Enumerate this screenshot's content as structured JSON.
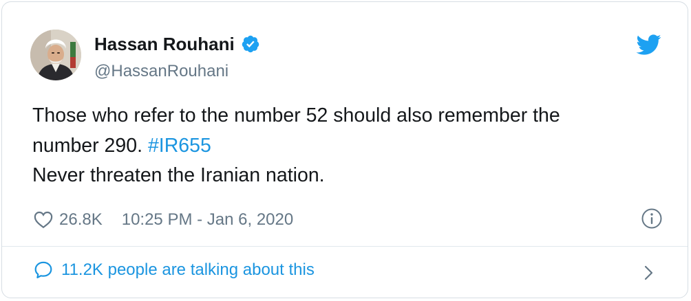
{
  "author": {
    "display_name": "Hassan Rouhani",
    "handle": "@HassanRouhani",
    "verified": true,
    "avatar_icon": "profile-photo"
  },
  "tweet": {
    "line1": "Those who refer to the number 52 should also remember the",
    "line2_text": "number 290. ",
    "hashtag": "#IR655",
    "line3": "Never threaten the Iranian nation."
  },
  "meta": {
    "like_icon": "heart-icon",
    "likes": "26.8K",
    "timestamp": "10:25 PM - Jan 6, 2020",
    "info_icon": "info-icon"
  },
  "footer": {
    "talk_icon": "speech-bubble-icon",
    "talk_text": "11.2K people are talking about this",
    "chevron_icon": "chevron-right-icon"
  },
  "colors": {
    "link": "#1b95e0",
    "text": "#14171a",
    "secondary": "#657786",
    "border": "#d6dde3",
    "twitter_blue": "#1da1f2"
  }
}
